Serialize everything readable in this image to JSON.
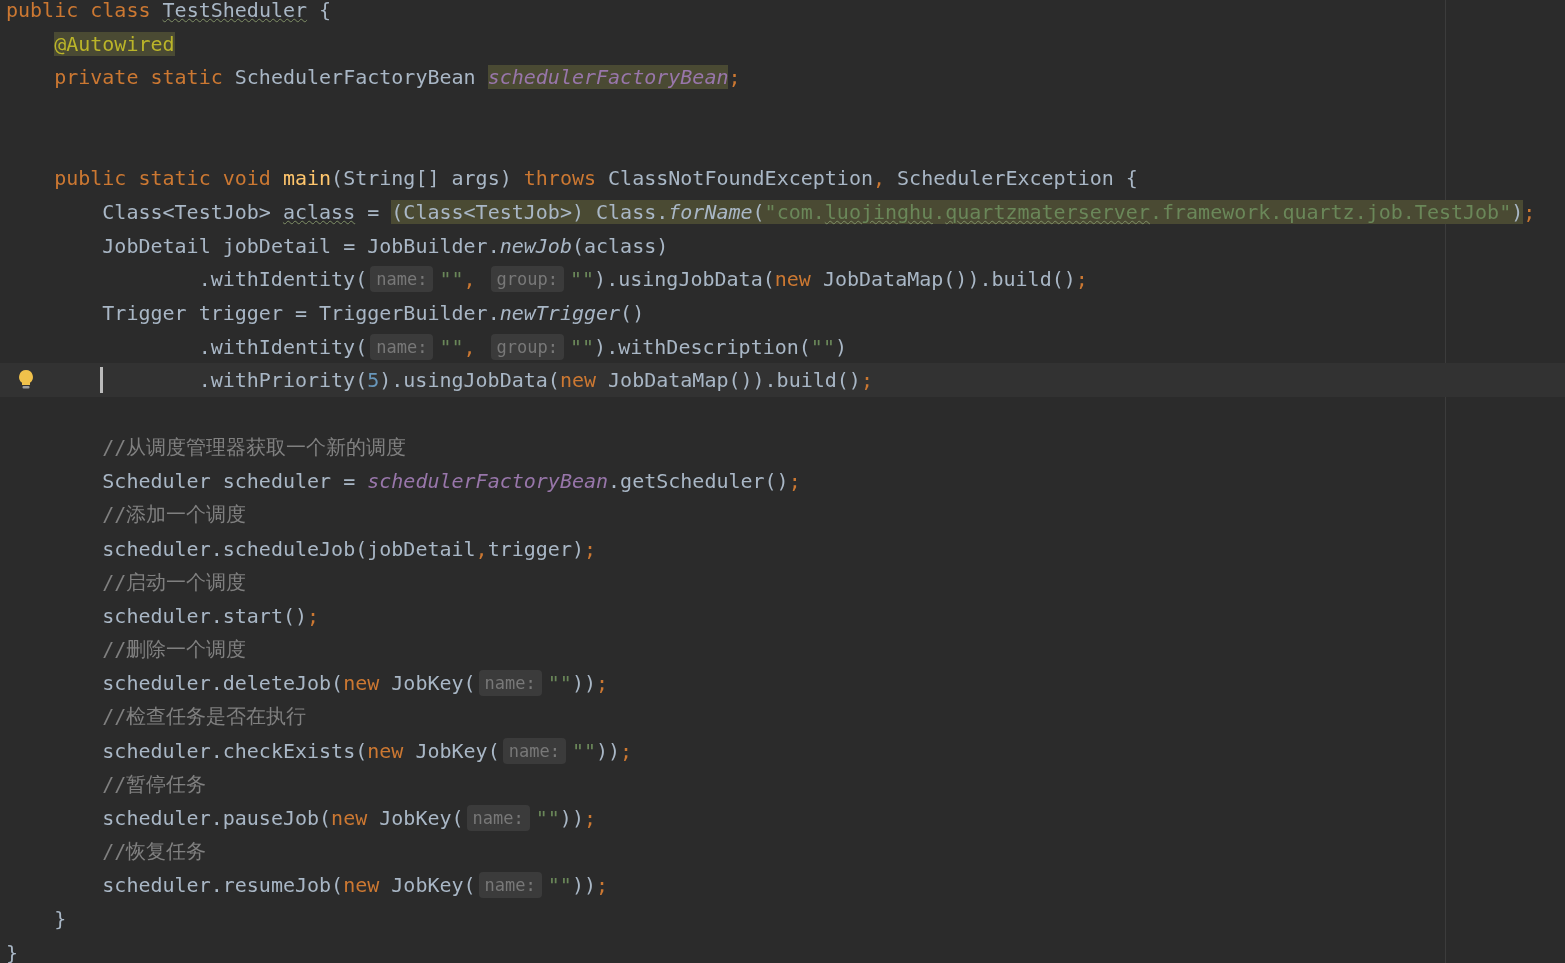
{
  "editor": {
    "lines": [
      {
        "current": false,
        "kind": "block",
        "tokens": [
          {
            "text": "public class ",
            "kind": "keyword",
            "highlighted": false,
            "misspelled": false
          },
          {
            "text": "TestSheduler",
            "kind": "plain",
            "highlighted": false,
            "misspelled": true
          },
          {
            "text": " {",
            "kind": "plain",
            "highlighted": false,
            "misspelled": false
          }
        ],
        "children": [
          {
            "current": false,
            "tokens": [
              {
                "text": "@Autowired",
                "kind": "annotation",
                "highlighted": true,
                "misspelled": false
              }
            ]
          },
          {
            "current": false,
            "tokens": [
              {
                "text": "private static ",
                "kind": "keyword",
                "highlighted": false,
                "misspelled": false
              },
              {
                "text": "SchedulerFactoryBean ",
                "kind": "plain",
                "highlighted": false,
                "misspelled": false
              },
              {
                "text": "schedulerFactoryBean",
                "kind": "field",
                "highlighted": true,
                "misspelled": false
              },
              {
                "text": ";",
                "kind": "keyword",
                "highlighted": false,
                "misspelled": false
              }
            ]
          },
          {
            "current": false
          },
          {
            "current": false
          },
          {
            "current": false,
            "kind": "block",
            "tokens": [
              {
                "text": "public static void ",
                "kind": "keyword",
                "highlighted": false,
                "misspelled": false
              },
              {
                "text": "main",
                "kind": "declaration",
                "highlighted": false,
                "misspelled": false
              },
              {
                "text": "(String[] args) ",
                "kind": "plain",
                "highlighted": false,
                "misspelled": false
              },
              {
                "text": "throws ",
                "kind": "keyword",
                "highlighted": false,
                "misspelled": false
              },
              {
                "text": "ClassNotFoundException",
                "kind": "plain",
                "highlighted": false,
                "misspelled": false
              },
              {
                "text": ", ",
                "kind": "keyword",
                "highlighted": false,
                "misspelled": false
              },
              {
                "text": "SchedulerException {",
                "kind": "plain",
                "highlighted": false,
                "misspelled": false
              }
            ],
            "children": [
              {
                "current": false,
                "tokens": [
                  {
                    "text": "Class<TestJob> ",
                    "kind": "plain",
                    "highlighted": false,
                    "misspelled": false
                  },
                  {
                    "text": "aclass",
                    "kind": "plain",
                    "highlighted": false,
                    "misspelled": true
                  },
                  {
                    "text": " = ",
                    "kind": "plain",
                    "highlighted": false,
                    "misspelled": false
                  },
                  {
                    "text": "(Class<TestJob>) Class.",
                    "kind": "plain",
                    "highlighted": true,
                    "misspelled": false
                  },
                  {
                    "text": "forName",
                    "kind": "static-call",
                    "highlighted": true,
                    "misspelled": false
                  },
                  {
                    "text": "(",
                    "kind": "plain",
                    "highlighted": true,
                    "misspelled": false
                  },
                  {
                    "text": "\"com.",
                    "kind": "string",
                    "highlighted": true,
                    "misspelled": false
                  },
                  {
                    "text": "luojinghu",
                    "kind": "string",
                    "highlighted": true,
                    "misspelled": true
                  },
                  {
                    "text": ".",
                    "kind": "string",
                    "highlighted": true,
                    "misspelled": false
                  },
                  {
                    "text": "quartzmaterserver",
                    "kind": "string",
                    "highlighted": true,
                    "misspelled": true
                  },
                  {
                    "text": ".framework.quartz.job.TestJob\"",
                    "kind": "string",
                    "highlighted": true,
                    "misspelled": false
                  },
                  {
                    "text": ")",
                    "kind": "plain",
                    "highlighted": true,
                    "misspelled": false
                  },
                  {
                    "text": ";",
                    "kind": "keyword",
                    "highlighted": false,
                    "misspelled": false
                  }
                ]
              },
              {
                "current": false,
                "kind": "statement",
                "tokens": [
                  {
                    "text": "JobDetail jobDetail = JobBuilder.",
                    "kind": "plain",
                    "highlighted": false,
                    "misspelled": false
                  },
                  {
                    "text": "newJob",
                    "kind": "static-call",
                    "highlighted": false,
                    "misspelled": false
                  },
                  {
                    "text": "(aclass)",
                    "kind": "plain",
                    "highlighted": false,
                    "misspelled": false
                  }
                ],
                "children": [
                  {
                    "current": false,
                    "tokens": [
                      {
                        "text": ".withIdentity(",
                        "kind": "plain",
                        "highlighted": false,
                        "misspelled": false
                      },
                      {
                        "text": "name:",
                        "kind": "hint",
                        "highlighted": false,
                        "misspelled": false
                      },
                      {
                        "text": "\"\"",
                        "kind": "string",
                        "highlighted": false,
                        "misspelled": false
                      },
                      {
                        "text": ", ",
                        "kind": "keyword",
                        "highlighted": false,
                        "misspelled": false
                      },
                      {
                        "text": "group:",
                        "kind": "hint",
                        "highlighted": false,
                        "misspelled": false
                      },
                      {
                        "text": "\"\"",
                        "kind": "string",
                        "highlighted": false,
                        "misspelled": false
                      },
                      {
                        "text": ").usingJobData(",
                        "kind": "plain",
                        "highlighted": false,
                        "misspelled": false
                      },
                      {
                        "text": "new ",
                        "kind": "keyword",
                        "highlighted": false,
                        "misspelled": false
                      },
                      {
                        "text": "JobDataMap()).build()",
                        "kind": "plain",
                        "highlighted": false,
                        "misspelled": false
                      },
                      {
                        "text": ";",
                        "kind": "keyword",
                        "highlighted": false,
                        "misspelled": false
                      }
                    ]
                  }
                ]
              },
              {
                "current": false,
                "kind": "statement",
                "tokens": [
                  {
                    "text": "Trigger trigger = TriggerBuilder.",
                    "kind": "plain",
                    "highlighted": false,
                    "misspelled": false
                  },
                  {
                    "text": "newTrigger",
                    "kind": "static-call",
                    "highlighted": false,
                    "misspelled": false
                  },
                  {
                    "text": "()",
                    "kind": "plain",
                    "highlighted": false,
                    "misspelled": false
                  }
                ],
                "children": [
                  {
                    "current": false,
                    "tokens": [
                      {
                        "text": ".withIdentity(",
                        "kind": "plain",
                        "highlighted": false,
                        "misspelled": false
                      },
                      {
                        "text": "name:",
                        "kind": "hint",
                        "highlighted": false,
                        "misspelled": false
                      },
                      {
                        "text": "\"\"",
                        "kind": "string",
                        "highlighted": false,
                        "misspelled": false
                      },
                      {
                        "text": ", ",
                        "kind": "keyword",
                        "highlighted": false,
                        "misspelled": false
                      },
                      {
                        "text": "group:",
                        "kind": "hint",
                        "highlighted": false,
                        "misspelled": false
                      },
                      {
                        "text": "\"\"",
                        "kind": "string",
                        "highlighted": false,
                        "misspelled": false
                      },
                      {
                        "text": ").withDescription(",
                        "kind": "plain",
                        "highlighted": false,
                        "misspelled": false
                      },
                      {
                        "text": "\"\"",
                        "kind": "string",
                        "highlighted": false,
                        "misspelled": false
                      },
                      {
                        "text": ")",
                        "kind": "plain",
                        "highlighted": false,
                        "misspelled": false
                      }
                    ]
                  },
                  {
                    "current": true,
                    "tokens": [
                      {
                        "text": ".withPriority(",
                        "kind": "plain",
                        "highlighted": false,
                        "misspelled": false
                      },
                      {
                        "text": "5",
                        "kind": "number",
                        "highlighted": false,
                        "misspelled": false
                      },
                      {
                        "text": ").usingJobData(",
                        "kind": "plain",
                        "highlighted": false,
                        "misspelled": false
                      },
                      {
                        "text": "new ",
                        "kind": "keyword",
                        "highlighted": false,
                        "misspelled": false
                      },
                      {
                        "text": "JobDataMap()).build()",
                        "kind": "plain",
                        "highlighted": false,
                        "misspelled": false
                      },
                      {
                        "text": ";",
                        "kind": "keyword",
                        "highlighted": false,
                        "misspelled": false
                      }
                    ]
                  }
                ]
              },
              {
                "current": false
              },
              {
                "current": false,
                "tokens": [
                  {
                    "text": "//从调度管理器获取一个新的调度",
                    "kind": "comment",
                    "highlighted": false,
                    "misspelled": false
                  }
                ]
              },
              {
                "current": false,
                "tokens": [
                  {
                    "text": "Scheduler scheduler = ",
                    "kind": "plain",
                    "highlighted": false,
                    "misspelled": false
                  },
                  {
                    "text": "schedulerFactoryBean",
                    "kind": "field",
                    "highlighted": false,
                    "misspelled": false
                  },
                  {
                    "text": ".getScheduler()",
                    "kind": "plain",
                    "highlighted": false,
                    "misspelled": false
                  },
                  {
                    "text": ";",
                    "kind": "keyword",
                    "highlighted": false,
                    "misspelled": false
                  }
                ]
              },
              {
                "current": false,
                "tokens": [
                  {
                    "text": "//添加一个调度",
                    "kind": "comment",
                    "highlighted": false,
                    "misspelled": false
                  }
                ]
              },
              {
                "current": false,
                "tokens": [
                  {
                    "text": "scheduler.scheduleJob(jobDetail",
                    "kind": "plain",
                    "highlighted": false,
                    "misspelled": false
                  },
                  {
                    "text": ",",
                    "kind": "keyword",
                    "highlighted": false,
                    "misspelled": false
                  },
                  {
                    "text": "trigger)",
                    "kind": "plain",
                    "highlighted": false,
                    "misspelled": false
                  },
                  {
                    "text": ";",
                    "kind": "keyword",
                    "highlighted": false,
                    "misspelled": false
                  }
                ]
              },
              {
                "current": false,
                "tokens": [
                  {
                    "text": "//启动一个调度",
                    "kind": "comment",
                    "highlighted": false,
                    "misspelled": false
                  }
                ]
              },
              {
                "current": false,
                "tokens": [
                  {
                    "text": "scheduler.start()",
                    "kind": "plain",
                    "highlighted": false,
                    "misspelled": false
                  },
                  {
                    "text": ";",
                    "kind": "keyword",
                    "highlighted": false,
                    "misspelled": false
                  }
                ]
              },
              {
                "current": false,
                "tokens": [
                  {
                    "text": "//删除一个调度",
                    "kind": "comment",
                    "highlighted": false,
                    "misspelled": false
                  }
                ]
              },
              {
                "current": false,
                "tokens": [
                  {
                    "text": "scheduler.deleteJob(",
                    "kind": "plain",
                    "highlighted": false,
                    "misspelled": false
                  },
                  {
                    "text": "new ",
                    "kind": "keyword",
                    "highlighted": false,
                    "misspelled": false
                  },
                  {
                    "text": "JobKey(",
                    "kind": "plain",
                    "highlighted": false,
                    "misspelled": false
                  },
                  {
                    "text": "name:",
                    "kind": "hint",
                    "highlighted": false,
                    "misspelled": false
                  },
                  {
                    "text": "\"\"",
                    "kind": "string",
                    "highlighted": false,
                    "misspelled": false
                  },
                  {
                    "text": "))",
                    "kind": "plain",
                    "highlighted": false,
                    "misspelled": false
                  },
                  {
                    "text": ";",
                    "kind": "keyword",
                    "highlighted": false,
                    "misspelled": false
                  }
                ]
              },
              {
                "current": false,
                "tokens": [
                  {
                    "text": "//检查任务是否在执行",
                    "kind": "comment",
                    "highlighted": false,
                    "misspelled": false
                  }
                ]
              },
              {
                "current": false,
                "tokens": [
                  {
                    "text": "scheduler.checkExists(",
                    "kind": "plain",
                    "highlighted": false,
                    "misspelled": false
                  },
                  {
                    "text": "new ",
                    "kind": "keyword",
                    "highlighted": false,
                    "misspelled": false
                  },
                  {
                    "text": "JobKey(",
                    "kind": "plain",
                    "highlighted": false,
                    "misspelled": false
                  },
                  {
                    "text": "name:",
                    "kind": "hint",
                    "highlighted": false,
                    "misspelled": false
                  },
                  {
                    "text": "\"\"",
                    "kind": "string",
                    "highlighted": false,
                    "misspelled": false
                  },
                  {
                    "text": "))",
                    "kind": "plain",
                    "highlighted": false,
                    "misspelled": false
                  },
                  {
                    "text": ";",
                    "kind": "keyword",
                    "highlighted": false,
                    "misspelled": false
                  }
                ]
              },
              {
                "current": false,
                "tokens": [
                  {
                    "text": "//暂停任务",
                    "kind": "comment",
                    "highlighted": false,
                    "misspelled": false
                  }
                ]
              },
              {
                "current": false,
                "tokens": [
                  {
                    "text": "scheduler.pauseJob(",
                    "kind": "plain",
                    "highlighted": false,
                    "misspelled": false
                  },
                  {
                    "text": "new ",
                    "kind": "keyword",
                    "highlighted": false,
                    "misspelled": false
                  },
                  {
                    "text": "JobKey(",
                    "kind": "plain",
                    "highlighted": false,
                    "misspelled": false
                  },
                  {
                    "text": "name:",
                    "kind": "hint",
                    "highlighted": false,
                    "misspelled": false
                  },
                  {
                    "text": "\"\"",
                    "kind": "string",
                    "highlighted": false,
                    "misspelled": false
                  },
                  {
                    "text": "))",
                    "kind": "plain",
                    "highlighted": false,
                    "misspelled": false
                  },
                  {
                    "text": ";",
                    "kind": "keyword",
                    "highlighted": false,
                    "misspelled": false
                  }
                ]
              },
              {
                "current": false,
                "tokens": [
                  {
                    "text": "//恢复任务",
                    "kind": "comment",
                    "highlighted": false,
                    "misspelled": false
                  }
                ]
              },
              {
                "current": false,
                "tokens": [
                  {
                    "text": "scheduler.resumeJob(",
                    "kind": "plain",
                    "highlighted": false,
                    "misspelled": false
                  },
                  {
                    "text": "new ",
                    "kind": "keyword",
                    "highlighted": false,
                    "misspelled": false
                  },
                  {
                    "text": "JobKey(",
                    "kind": "plain",
                    "highlighted": false,
                    "misspelled": false
                  },
                  {
                    "text": "name:",
                    "kind": "hint",
                    "highlighted": false,
                    "misspelled": false
                  },
                  {
                    "text": "\"\"",
                    "kind": "string",
                    "highlighted": false,
                    "misspelled": false
                  },
                  {
                    "text": "))",
                    "kind": "plain",
                    "highlighted": false,
                    "misspelled": false
                  },
                  {
                    "text": ";",
                    "kind": "keyword",
                    "highlighted": false,
                    "misspelled": false
                  }
                ]
              }
            ]
          },
          {
            "current": false,
            "tokens": [
              {
                "text": "}",
                "kind": "plain",
                "highlighted": false,
                "misspelled": false
              }
            ]
          }
        ]
      },
      {
        "current": false,
        "tokens": [
          {
            "text": "}",
            "kind": "plain",
            "highlighted": false
          }
        ]
      }
    ]
  }
}
